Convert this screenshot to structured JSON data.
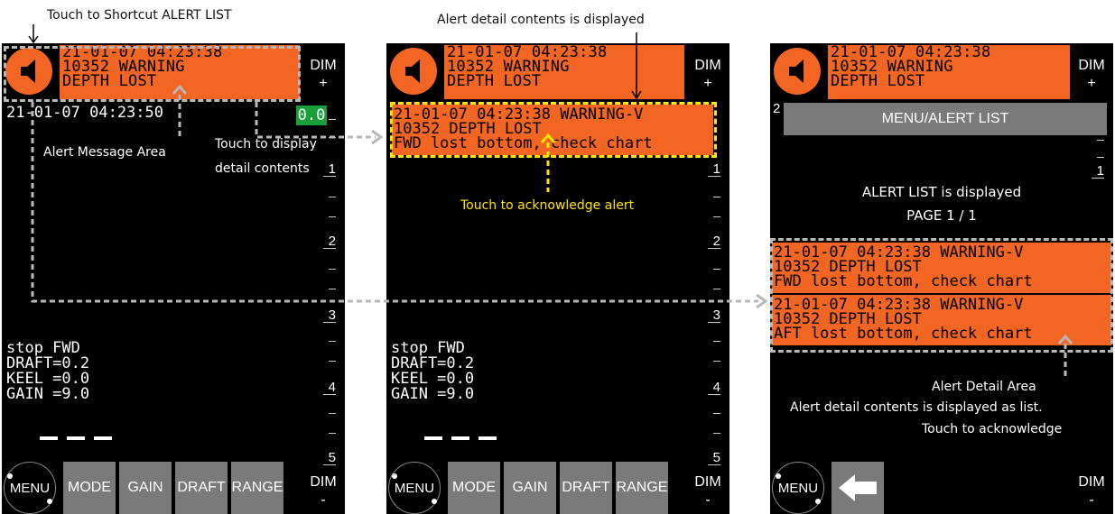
{
  "callouts": {
    "shortcut": "Touch to Shortcut ALERT LIST",
    "detail_top": "Alert detail contents is displayed",
    "alert_msg_area": "Alert Message Area",
    "touch_display_1": "Touch to display",
    "touch_display_2": "detail contents",
    "touch_ack": "Touch to acknowledge alert",
    "alert_list_displayed": "ALERT LIST is displayed",
    "page": "PAGE 1 / 1",
    "alert_detail_area": "Alert Detail Area",
    "detail_as_list": "Alert detail contents is displayed as list.",
    "touch_to_ack": "Touch to acknowledge"
  },
  "alert": {
    "time": "21-01-07 04:23:38",
    "line2": "10352 WARNING",
    "line3": "DEPTH LOST"
  },
  "dim": {
    "label": "DIM",
    "plus": "+",
    "minus": "-"
  },
  "screen1": {
    "clock": "21-01-07 04:23:50",
    "depth_value": "0.0",
    "scale": [
      "1",
      "2",
      "3",
      "4",
      "5"
    ],
    "status": [
      "stop FWD",
      "DRAFT=0.2",
      "KEEL =0.0",
      "GAIN =9.0"
    ]
  },
  "detail_popup": {
    "line1": "21-01-07 04:23:38 WARNING-V",
    "line2": "10352 DEPTH LOST",
    "line3": "FWD lost bottom, check chart"
  },
  "alert_list": {
    "header": "MENU/ALERT LIST",
    "scale_top": "2",
    "scale_one": "1",
    "items": [
      {
        "line1": "21-01-07 04:23:38 WARNING-V",
        "line2": "10352 DEPTH LOST",
        "line3": "FWD lost bottom, check chart"
      },
      {
        "line1": "21-01-07 04:23:38 WARNING-V",
        "line2": "10352 DEPTH LOST",
        "line3": "AFT lost bottom, check chart"
      }
    ]
  },
  "bottom_buttons": {
    "menu": "MENU",
    "mode": "MODE",
    "gain": "GAIN",
    "draft": "DRAFT",
    "range": "RANGE"
  },
  "colors": {
    "alert_orange": "#f26522",
    "button_grey": "#7a7a7a",
    "depth_green": "#1a9e3a",
    "callout_yellow": "#ffe600"
  }
}
